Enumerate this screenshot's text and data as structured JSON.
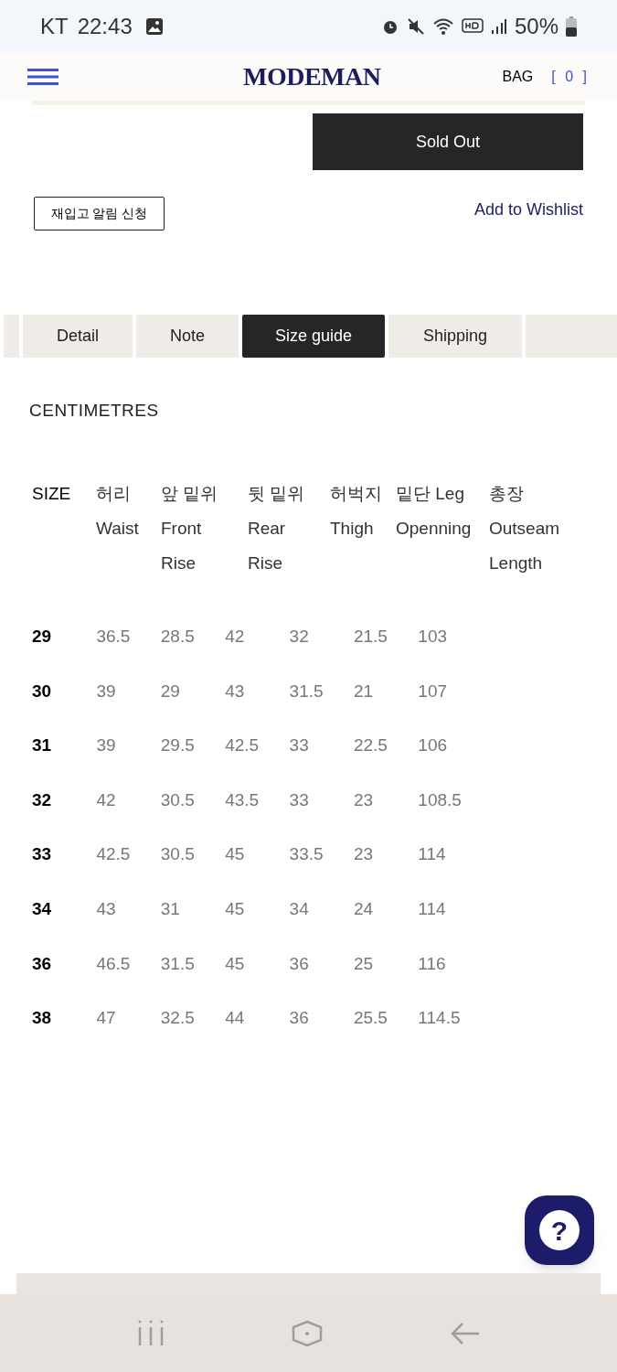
{
  "status_bar": {
    "carrier": "KT",
    "time": "22:43",
    "battery": "50%"
  },
  "header": {
    "logo": "MODEMAN",
    "bag": "BAG",
    "bag_count": "[ 0 ]"
  },
  "sold_out": "Sold Out",
  "restock": "재입고 알림 신청",
  "wishlist": "Add to Wishlist",
  "tabs": [
    {
      "selected": false
    },
    {
      "label": "Detail",
      "selected": false
    },
    {
      "label": "Note",
      "selected": false
    },
    {
      "label": "Size guide",
      "selected": true
    },
    {
      "label": "Shipping",
      "selected": false
    },
    {
      "selected": false
    }
  ],
  "unit": "CENTIMETRES",
  "size_header": {
    "headings": [
      "SIZE",
      "허리\nWaist",
      "앞 밑위\nFront\nRise",
      "뒷 밑위\nRear\nRise",
      "허벅지\nThigh",
      "밑단 Leg\nOpenning",
      "총장\nOutseam\nLength"
    ]
  },
  "size_values": {
    "lines": [
      [
        "29",
        "36.5",
        "28.5",
        "42",
        "32",
        "21.5",
        "103"
      ],
      [
        "30",
        "39",
        "29",
        "43",
        "31.5",
        "21",
        "107"
      ],
      [
        "31",
        "39",
        "29.5",
        "42.5",
        "33",
        "22.5",
        "106"
      ],
      [
        "32",
        "42",
        "30.5",
        "43.5",
        "33",
        "23",
        "108.5"
      ],
      [
        "33",
        "42.5",
        "30.5",
        "45",
        "33.5",
        "23",
        "114"
      ],
      [
        "34",
        "43",
        "31",
        "45",
        "34",
        "24",
        "114"
      ],
      [
        "36",
        "46.5",
        "31.5",
        "45",
        "36",
        "25",
        "116"
      ],
      [
        "38",
        "47",
        "32.5",
        "44",
        "36",
        "25.5",
        "114.5"
      ]
    ]
  },
  "help_button": "?"
}
